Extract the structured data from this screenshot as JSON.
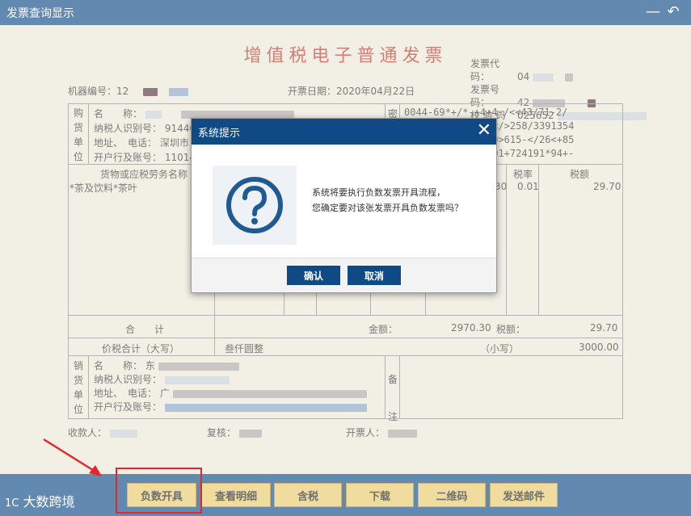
{
  "window": {
    "title": "发票查询显示",
    "minimize_glyph": "—",
    "back_glyph": "↶"
  },
  "invoice": {
    "title": "增值税电子普通发票",
    "code_label": "发票代码：",
    "code_value": "04",
    "number_label": "发票号码：",
    "number_value": "42",
    "check_label": "校 验 码",
    "check_value": "025652",
    "machine_label": "机器编号：",
    "machine_value": "12",
    "date_label": "开票日期：",
    "date_value": "2020年04月22日",
    "buyer_side": [
      "购",
      "货",
      "单",
      "位"
    ],
    "buyer_fields": [
      "名　　称：",
      "纳税人识别号：",
      "地址、　电话：",
      "开户行及账号："
    ],
    "buyer_values": [
      "",
      "91440",
      "深圳市",
      "11014"
    ],
    "cipher_side": "密",
    "cipher_lines": [
      "0044-69*+/*-+4+4-/<<43/71-2/",
      "<</>258/3391354",
      "00>615-</26<+85",
      "<01+724191*94+-"
    ],
    "goods_header": "货物或应税劳务名称",
    "goods_item": "*茶及饮料*茶叶",
    "rate_header": "税率",
    "tax_header": "税额",
    "rate_value": "30",
    "rate_value2": "0.01",
    "tax_value": "29.70",
    "total_label": "合　　计",
    "amount_label": "金额：",
    "amount_value": "2970.30",
    "tax_total_label": "税额：",
    "tax_total_value": "29.70",
    "price_total_label": "价税合计（大写）",
    "price_total_upper": "叁仟圆整",
    "small_label": "（小写）",
    "small_value": "3000.00",
    "seller_side": [
      "销",
      "货",
      "单",
      "位"
    ],
    "seller_fields": [
      "名　　称：",
      "纳税人识别号：",
      "地址、　电话：",
      "开户行及账号："
    ],
    "seller_values": [
      "东",
      "",
      "广",
      ""
    ],
    "remark_side": [
      "备",
      "注"
    ],
    "payee_label": "收款人：",
    "reviewer_label": "复核：",
    "issuer_label": "开票人："
  },
  "watermark": "大数跨境",
  "watermark_logo": "1C",
  "actions": [
    {
      "label": "负数开具"
    },
    {
      "label": "查看明细"
    },
    {
      "label": "含税"
    },
    {
      "label": "下载"
    },
    {
      "label": "二维码"
    },
    {
      "label": "发送邮件"
    }
  ],
  "dialog": {
    "title": "系统提示",
    "close_glyph": "✕",
    "line1": "系统将要执行负数发票开具流程，",
    "line2": "您确定要对该张发票开具负数发票吗？",
    "confirm": "确认",
    "cancel": "取消"
  },
  "colors": {
    "brand": "#0f4a86",
    "accent_button": "#e8c96a",
    "invoice_red": "#c0392b",
    "annotation_red": "#e8262a"
  },
  "icons": [
    "question-icon",
    "close-icon",
    "minimize-icon",
    "back-icon",
    "arrow-annotation-icon"
  ]
}
